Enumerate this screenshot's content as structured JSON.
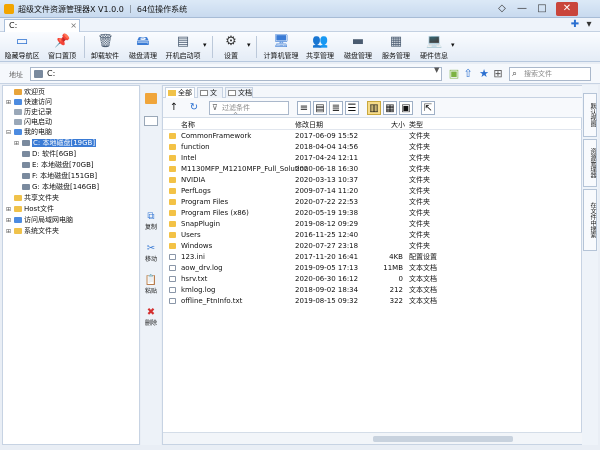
{
  "window": {
    "title": "超级文件资源管理器X V1.0.0 ｜ 64位操作系统",
    "pin_glyph": "◇",
    "min_glyph": "—",
    "max_glyph": "□",
    "close_glyph": "✕"
  },
  "tabbar": {
    "tab_label": "C:",
    "tab_close": "×",
    "add_tab": "✚",
    "menu_glyph": "▾"
  },
  "toolbar": [
    {
      "label": "隐藏导航区",
      "icon": "hide-nav-icon",
      "glyph": "▭"
    },
    {
      "label": "窗口置顶",
      "icon": "pin-icon",
      "glyph": "📌"
    },
    {
      "label": "卸载软件",
      "icon": "uninstall-icon",
      "glyph": "🗑"
    },
    {
      "label": "磁盘清理",
      "icon": "disk-cleanup-icon",
      "glyph": "🖴"
    },
    {
      "label": "开机启动项",
      "icon": "startup-icon",
      "glyph": "▤"
    },
    {
      "label": "设置",
      "icon": "settings-gear-icon",
      "glyph": "⚙"
    },
    {
      "label": "计算机管理",
      "icon": "computer-management-icon",
      "glyph": "🖥"
    },
    {
      "label": "共享管理",
      "icon": "share-management-icon",
      "glyph": "👥"
    },
    {
      "label": "磁盘管理",
      "icon": "disk-management-icon",
      "glyph": "▬"
    },
    {
      "label": "服务管理",
      "icon": "service-management-icon",
      "glyph": "▦"
    },
    {
      "label": "硬件信息",
      "icon": "hardware-info-icon",
      "glyph": "💻"
    }
  ],
  "dropdown_glyph": "▾",
  "address": {
    "label": "地址",
    "value": "C:",
    "chevron": "▼",
    "search_placeholder": "搜索文件",
    "search_glyph": "⌕"
  },
  "tree": [
    {
      "label": "欢迎页",
      "expander": "",
      "icon_color": "#e8a43a",
      "indent": 0
    },
    {
      "label": "快速访问",
      "expander": "⊞",
      "icon_color": "#4c8be0",
      "indent": 0
    },
    {
      "label": "历史记录",
      "expander": "",
      "icon_color": "#9aa8b8",
      "indent": 0
    },
    {
      "label": "闪电启动",
      "expander": "",
      "icon_color": "#9aa8b8",
      "indent": 0
    },
    {
      "label": "我的电脑",
      "expander": "⊟",
      "icon_color": "#4c8be0",
      "indent": 0
    },
    {
      "label": "C: 本地磁盘[19GB]",
      "expander": "⊞",
      "icon_color": "#7a8a9e",
      "indent": 1,
      "selected": true
    },
    {
      "label": "D: 软件[6GB]",
      "expander": "",
      "icon_color": "#7a8a9e",
      "indent": 1
    },
    {
      "label": "E: 本地磁盘[70GB]",
      "expander": "",
      "icon_color": "#7a8a9e",
      "indent": 1
    },
    {
      "label": "F: 本地磁盘[151GB]",
      "expander": "",
      "icon_color": "#7a8a9e",
      "indent": 1
    },
    {
      "label": "G: 本地磁盘[146GB]",
      "expander": "",
      "icon_color": "#7a8a9e",
      "indent": 1
    },
    {
      "label": "共享文件夹",
      "expander": "",
      "icon_color": "#f0c24a",
      "indent": 0
    },
    {
      "label": "Host文件",
      "expander": "⊞",
      "icon_color": "#f0c24a",
      "indent": 0
    },
    {
      "label": "访问局域网电脑",
      "expander": "⊞",
      "icon_color": "#4c8be0",
      "indent": 0
    },
    {
      "label": "系统文件夹",
      "expander": "⊞",
      "icon_color": "#f0c24a",
      "indent": 0
    }
  ],
  "actions": [
    {
      "label": "复制",
      "icon": "copy-icon",
      "glyph": "⧉"
    },
    {
      "label": "移动",
      "icon": "cut-icon",
      "glyph": "✂"
    },
    {
      "label": "粘贴",
      "icon": "paste-icon",
      "glyph": "📋"
    },
    {
      "label": "删除",
      "icon": "delete-icon",
      "glyph": "✖"
    }
  ],
  "main_tabs": [
    {
      "label": "全部"
    },
    {
      "label": "文件"
    },
    {
      "label": "文档"
    }
  ],
  "file_toolbar": {
    "up_glyph": "↑",
    "refresh_glyph": "↻",
    "filter_placeholder": "过滤条件",
    "filter_glyph": "⊽",
    "view_glyphs": [
      "≡",
      "▤",
      "≣",
      "☰",
      "▥",
      "▦",
      "▣",
      "⇱"
    ]
  },
  "columns": {
    "name": "名称",
    "date": "修改日期",
    "size": "大小",
    "type": "类型",
    "sort_glyph": "^"
  },
  "files": [
    {
      "name": "CommonFramework",
      "date": "2017-06-09 15:52",
      "size": "",
      "type": "文件夹",
      "kind": "folder"
    },
    {
      "name": "function",
      "date": "2018-04-04 14:56",
      "size": "",
      "type": "文件夹",
      "kind": "folder"
    },
    {
      "name": "Intel",
      "date": "2017-04-24 12:11",
      "size": "",
      "type": "文件夹",
      "kind": "folder"
    },
    {
      "name": "M1130MFP_M1210MFP_Full_Solution",
      "date": "2020-06-18 16:30",
      "size": "",
      "type": "文件夹",
      "kind": "folder"
    },
    {
      "name": "NVIDIA",
      "date": "2020-03-13 10:37",
      "size": "",
      "type": "文件夹",
      "kind": "folder"
    },
    {
      "name": "PerfLogs",
      "date": "2009-07-14 11:20",
      "size": "",
      "type": "文件夹",
      "kind": "folder"
    },
    {
      "name": "Program Files",
      "date": "2020-07-22 22:53",
      "size": "",
      "type": "文件夹",
      "kind": "folder"
    },
    {
      "name": "Program Files (x86)",
      "date": "2020-05-19 19:38",
      "size": "",
      "type": "文件夹",
      "kind": "folder"
    },
    {
      "name": "SnapPlugin",
      "date": "2019-08-12 09:29",
      "size": "",
      "type": "文件夹",
      "kind": "folder"
    },
    {
      "name": "Users",
      "date": "2016-11-25 12:40",
      "size": "",
      "type": "文件夹",
      "kind": "folder"
    },
    {
      "name": "Windows",
      "date": "2020-07-27 23:18",
      "size": "",
      "type": "文件夹",
      "kind": "folder"
    },
    {
      "name": "123.ini",
      "date": "2017-11-20 16:41",
      "size": "4KB",
      "type": "配置设置",
      "kind": "file"
    },
    {
      "name": "aow_drv.log",
      "date": "2019-09-05 17:13",
      "size": "11MB",
      "type": "文本文档",
      "kind": "file"
    },
    {
      "name": "hsrv.txt",
      "date": "2020-06-30 16:12",
      "size": "0",
      "type": "文本文档",
      "kind": "file"
    },
    {
      "name": "kmlog.log",
      "date": "2018-09-02 18:34",
      "size": "212",
      "type": "文本文档",
      "kind": "file"
    },
    {
      "name": "offline_FtnInfo.txt",
      "date": "2019-08-15 09:32",
      "size": "322",
      "type": "文本文档",
      "kind": "file"
    }
  ],
  "side_tabs": [
    "默认视图",
    "资源管理器",
    "在文件中搜索"
  ],
  "colors": {
    "accent": "#3a7bd5",
    "folder": "#f3c246",
    "close_red": "#c9453b"
  }
}
